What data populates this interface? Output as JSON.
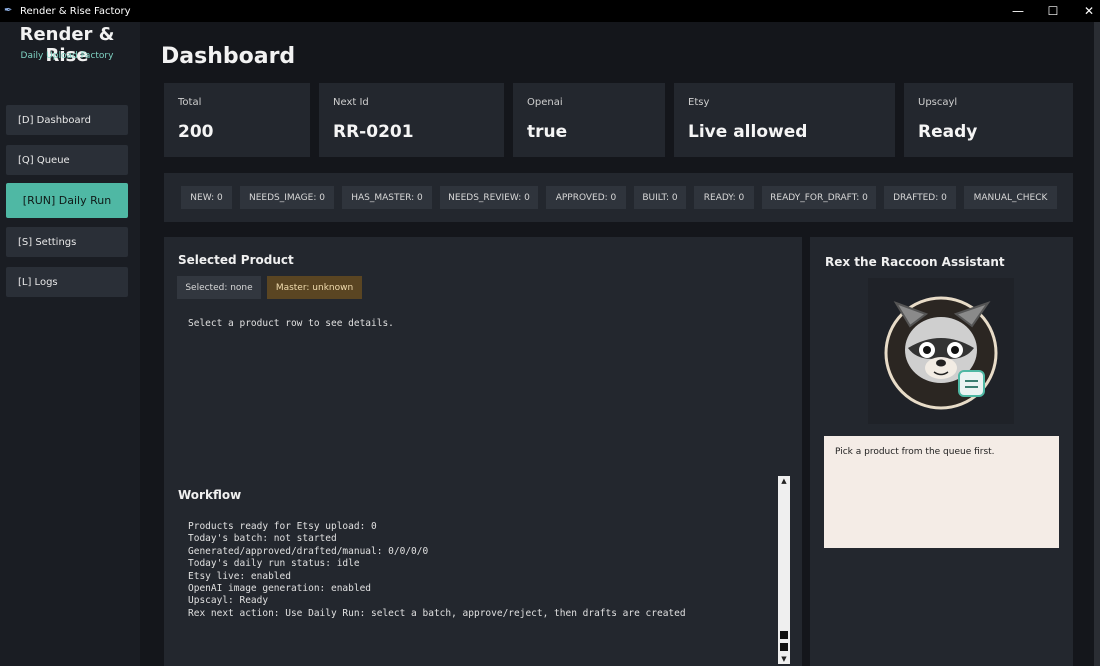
{
  "window": {
    "title": "Render & Rise Factory",
    "controls": [
      "minimize-icon",
      "maximize-icon",
      "close-icon"
    ]
  },
  "sidebar": {
    "brand": "Render & Rise",
    "tagline": "Daily Upload Factory",
    "items": [
      {
        "label": "[D] Dashboard",
        "active": false
      },
      {
        "label": "[Q] Queue",
        "active": false
      },
      {
        "label": "[RUN] Daily Run",
        "active": true
      },
      {
        "label": "[S] Settings",
        "active": false
      },
      {
        "label": "[L] Logs",
        "active": false
      }
    ]
  },
  "page": {
    "title": "Dashboard"
  },
  "stats": [
    {
      "label": "Total",
      "value": "200"
    },
    {
      "label": "Next Id",
      "value": "RR-0201"
    },
    {
      "label": "Openai",
      "value": "true"
    },
    {
      "label": "Etsy",
      "value": "Live allowed"
    },
    {
      "label": "Upscayl",
      "value": "Ready"
    }
  ],
  "status_chips": [
    "NEW: 0",
    "NEEDS_IMAGE: 0",
    "HAS_MASTER: 0",
    "NEEDS_REVIEW: 0",
    "APPROVED: 0",
    "BUILT: 0",
    "READY: 0",
    "READY_FOR_DRAFT: 0",
    "DRAFTED: 0",
    "MANUAL_CHECK"
  ],
  "selected_product": {
    "title": "Selected Product",
    "selected_badge": "Selected: none",
    "master_badge": "Master: unknown",
    "details": "Select a product row to see details."
  },
  "workflow": {
    "title": "Workflow",
    "lines": [
      "Products ready for Etsy upload: 0",
      "Today's batch: not started",
      "Generated/approved/drafted/manual: 0/0/0/0",
      "Today's daily run status: idle",
      "Etsy live: enabled",
      "OpenAI image generation: enabled",
      "Upscayl: Ready",
      "Rex next action: Use Daily Run: select a batch, approve/reject, then drafts are created"
    ]
  },
  "assistant": {
    "title": "Rex the Raccoon Assistant",
    "message": "Pick a product from the queue first."
  },
  "colors": {
    "accent": "#4fb8a4",
    "panel": "#23272e",
    "master_badge": "#5a4522"
  }
}
